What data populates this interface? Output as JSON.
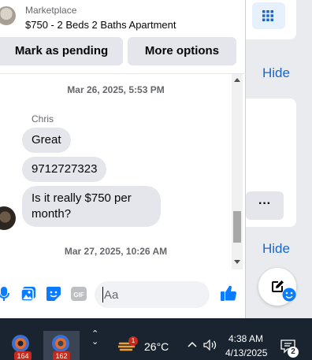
{
  "header": {
    "kicker": "Marketplace",
    "listing_title": "$750 - 2 Beds 2 Baths Apartment"
  },
  "actions": {
    "mark_pending_label": "Mark as pending",
    "more_options_label": "More options"
  },
  "conversation": {
    "timestamp_1": "Mar 26, 2025, 5:53 PM",
    "sender": "Chris",
    "messages": [
      "Great",
      "9712727323",
      "Is it really $750 per month?"
    ],
    "timestamp_2": "Mar 27, 2025, 10:26 AM"
  },
  "composer": {
    "placeholder": "Aa",
    "icons": [
      "microphone-icon",
      "photo-icon",
      "sticker-icon",
      "gif-icon",
      "emoji-icon",
      "thumbs-up-icon"
    ]
  },
  "right_panel": {
    "hide_label_1": "Hide",
    "hide_label_2": "Hide",
    "more_label": "···"
  },
  "taskbar": {
    "app_badge_1": "164",
    "app_badge_2": "162",
    "weather_badge": "1",
    "temperature": "26°C",
    "time": "4:38 AM",
    "date": "4/13/2025",
    "notification_count": "2"
  },
  "colors": {
    "accent": "#1b66c9",
    "messenger_blue": "#0a7cff",
    "bubble_gray": "#e4e6eb",
    "taskbar": "#1a2430",
    "badge_red": "#c42b1c"
  }
}
